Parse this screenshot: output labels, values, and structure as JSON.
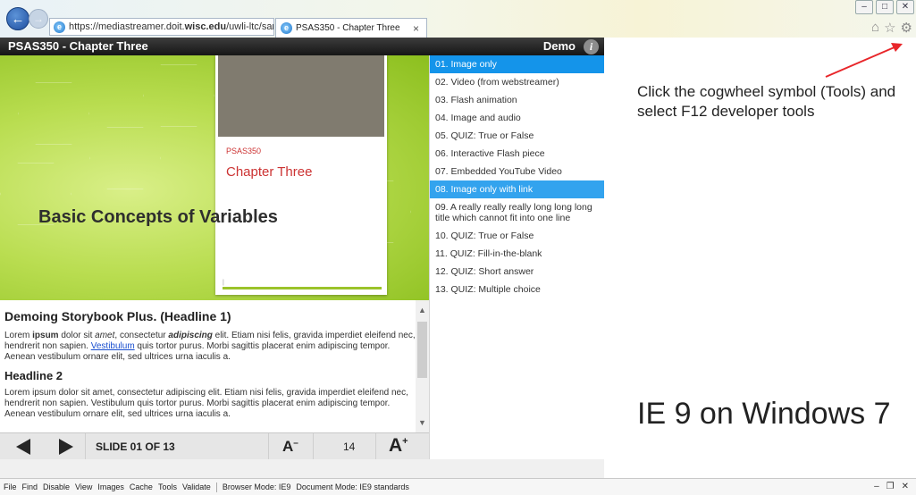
{
  "browser": {
    "address_prefix": "https://mediastreamer.doit.",
    "address_bold": "wisc.edu",
    "address_suffix": "/uwli-ltc/sandl",
    "address_tools": "⌕ ▾ 🔒 ↻",
    "tab_title": "PSAS350 - Chapter Three",
    "tab_close": "×",
    "window_controls": [
      "–",
      "□",
      "✕"
    ],
    "toolbar_icons": [
      "home-icon",
      "star-icon",
      "gear-icon"
    ]
  },
  "app": {
    "title": "PSAS350 - Chapter Three",
    "demo_label": "Demo",
    "info_glyph": "i"
  },
  "slide": {
    "course": "PSAS350",
    "chapter": "Chapter Three",
    "heading": "Basic Concepts of Variables",
    "footer_mark": "|"
  },
  "content": {
    "headline1": "Demoing Storybook Plus. (Headline 1)",
    "p1": {
      "t1": "Lorem ",
      "b1": "ipsum",
      "t2": " dolor sit ",
      "i1": "amet",
      "t3": ", consectetur ",
      "bi1": "adipiscing",
      "t4": " elit. Etiam nisi felis, gravida imperdiet eleifend nec, hendrerit non sapien. ",
      "link": "Vestibulum",
      "t5": " quis tortor purus. Morbi sagittis placerat enim adipiscing tempor. Aenean vestibulum ornare elit, sed ultrices urna iaculis a."
    },
    "headline2": "Headline 2",
    "p2": "Lorem ipsum dolor sit amet, consectetur adipiscing elit. Etiam nisi felis, gravida imperdiet eleifend nec, hendrerit non sapien. Vestibulum quis tortor purus. Morbi sagittis placerat enim adipiscing tempor. Aenean vestibulum ornare elit, sed ultrices urna iaculis a."
  },
  "controls": {
    "slide_label": "SLIDE 01 OF 13",
    "font_down": "A",
    "font_down_sup": "–",
    "font_size": "14",
    "font_up": "A",
    "font_up_sup": "+"
  },
  "menu": {
    "items": [
      "01. Image only",
      "02. Video (from webstreamer)",
      "03. Flash animation",
      "04. Image and audio",
      "05. QUIZ: True or False",
      "06. Interactive Flash piece",
      "07. Embedded YouTube Video",
      "08. Image only with link",
      "09. A really really really long long long title which cannot fit into one line",
      "10. QUIZ: True or False",
      "11. QUIZ: Fill-in-the-blank",
      "12. QUIZ: Short answer",
      "13. QUIZ: Multiple choice"
    ],
    "selected_index": 0,
    "highlight_index": 7,
    "selected_color": "#1494ea"
  },
  "annotation": {
    "note": "Click the cogwheel symbol (Tools) and select F12 developer tools",
    "caption": "IE 9 on Windows 7",
    "arrow_color": "#e8262a"
  },
  "devtools": {
    "menu": [
      "File",
      "Find",
      "Disable",
      "View",
      "Images",
      "Cache",
      "Tools",
      "Validate"
    ],
    "browser_mode": "Browser Mode: IE9",
    "document_mode": "Document Mode: IE9 standards",
    "window_controls": [
      "–",
      "❐",
      "✕"
    ]
  }
}
